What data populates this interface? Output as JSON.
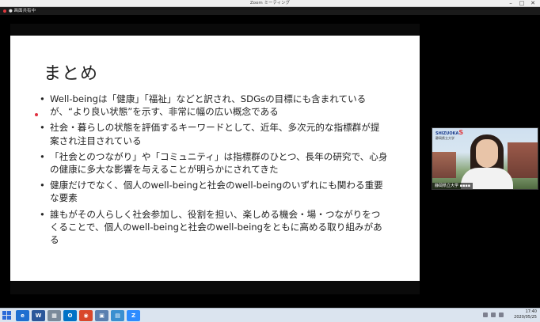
{
  "window": {
    "title": "Zoom ミーティング"
  },
  "sharebar": {
    "label": "● 画面共有中"
  },
  "slide": {
    "title": "まとめ",
    "bullets": [
      "Well-beingは「健康」「福祉」などと訳され、SDGsの目標にも含まれているが、“より良い状態”を示す、非常に幅の広い概念である",
      "社会・暮らしの状態を評価するキーワードとして、近年、多次元的な指標群が提案され注目されている",
      "「社会とのつながり」や「コミュニティ」は指標群のひとつ、長年の研究で、心身の健康に多大な影響を与えることが明らかにされてきた",
      "健康だけでなく、個人のwell-beingと社会のwell-beingのいずれにも関わる重要な要素",
      "誰もがその人らしく社会参加し、役割を担い、楽しめる機会・場・つながりをつくることで、個人のwell-beingと社会のwell-beingをともに高める取り組みがある"
    ]
  },
  "video": {
    "logo_main": "SHIZUOKA",
    "logo_s": "S",
    "logo_sub": "静岡県立大学",
    "name": "静岡県立大学 ▪▪▪▪"
  },
  "taskbar": {
    "apps": [
      {
        "label": "e",
        "color": "#1e6fd0"
      },
      {
        "label": "W",
        "color": "#2b579a"
      },
      {
        "label": "▦",
        "color": "#7a8a9a"
      },
      {
        "label": "O",
        "color": "#0072c6"
      },
      {
        "label": "◉",
        "color": "#d9472b"
      },
      {
        "label": "▣",
        "color": "#5a7fb0"
      },
      {
        "label": "▤",
        "color": "#3a8fd0"
      },
      {
        "label": "Z",
        "color": "#2d8cff"
      }
    ],
    "time": "17:40",
    "date": "2020/05/25"
  }
}
